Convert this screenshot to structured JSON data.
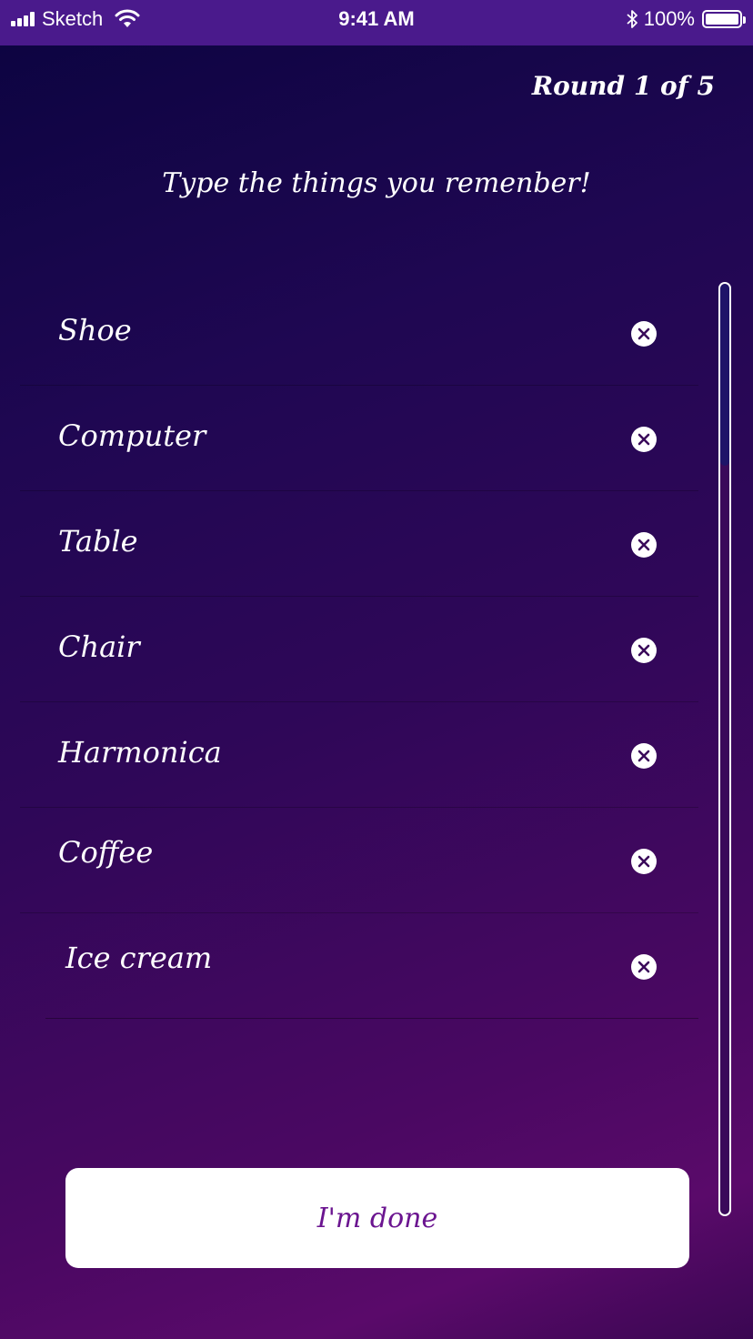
{
  "status_bar": {
    "carrier": "Sketch",
    "time": "9:41 AM",
    "battery_percent": "100%",
    "icons": [
      "signal-bars-icon",
      "wifi-icon",
      "bluetooth-icon",
      "battery-icon"
    ]
  },
  "header": {
    "round_label": "Round 1 of 5"
  },
  "prompt": "Type the things you remenber!",
  "items": [
    {
      "label": "Shoe"
    },
    {
      "label": "Computer"
    },
    {
      "label": "Table"
    },
    {
      "label": "Chair"
    },
    {
      "label": "Harmonica"
    },
    {
      "label": "Coffee"
    },
    {
      "label": "Ice cream"
    }
  ],
  "remove_icon": "close-circle-icon",
  "done_button": {
    "label": "I'm done"
  },
  "colors": {
    "status_bar": "#4a1a8c",
    "background_top": "#0b0440",
    "background_bottom": "#5a0a6a",
    "button_text": "#6b1590",
    "text": "#ffffff"
  }
}
